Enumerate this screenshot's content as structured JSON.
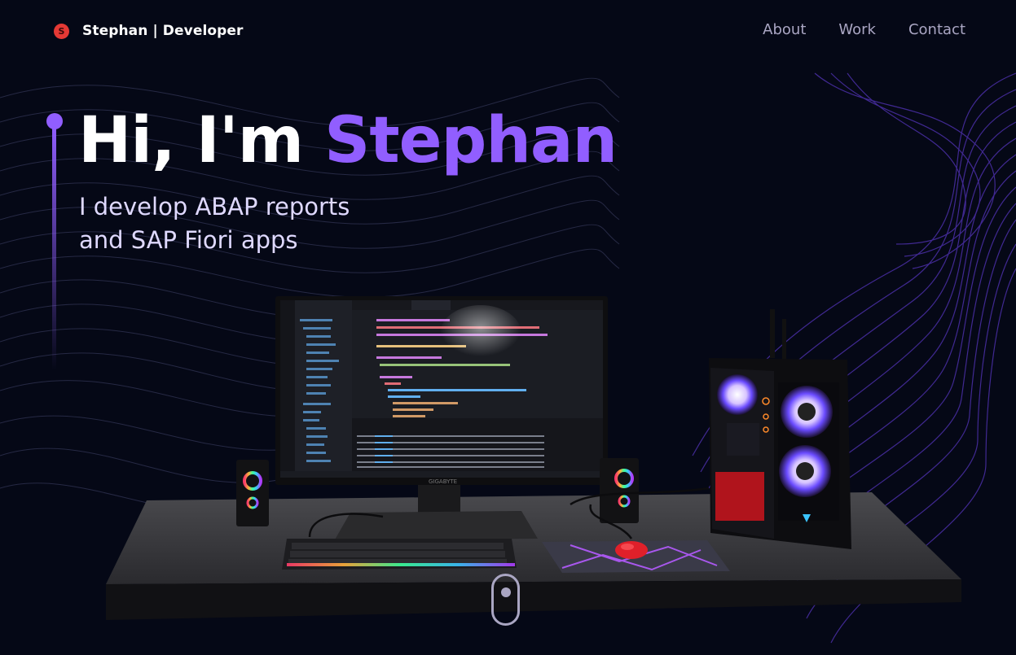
{
  "nav": {
    "logo_letter": "S",
    "brand": "Stephan | Developer",
    "links": [
      "About",
      "Work",
      "Contact"
    ]
  },
  "hero": {
    "title_prefix": "Hi, I'm ",
    "title_name": "Stephan",
    "subtitle_line1": "I develop ABAP reports",
    "subtitle_line2": "and SAP Fiori apps"
  },
  "colors": {
    "background": "#050816",
    "accent": "#915eff",
    "nav_text": "#aaa6c3",
    "subtitle_text": "#dfd9ff"
  },
  "scene": {
    "monitor_brand": "GIGABYTE",
    "icons": [
      "desk-icon",
      "monitor-icon",
      "keyboard-icon",
      "mouse-icon",
      "mousepad-icon",
      "speaker-icon",
      "pc-tower-icon"
    ]
  }
}
